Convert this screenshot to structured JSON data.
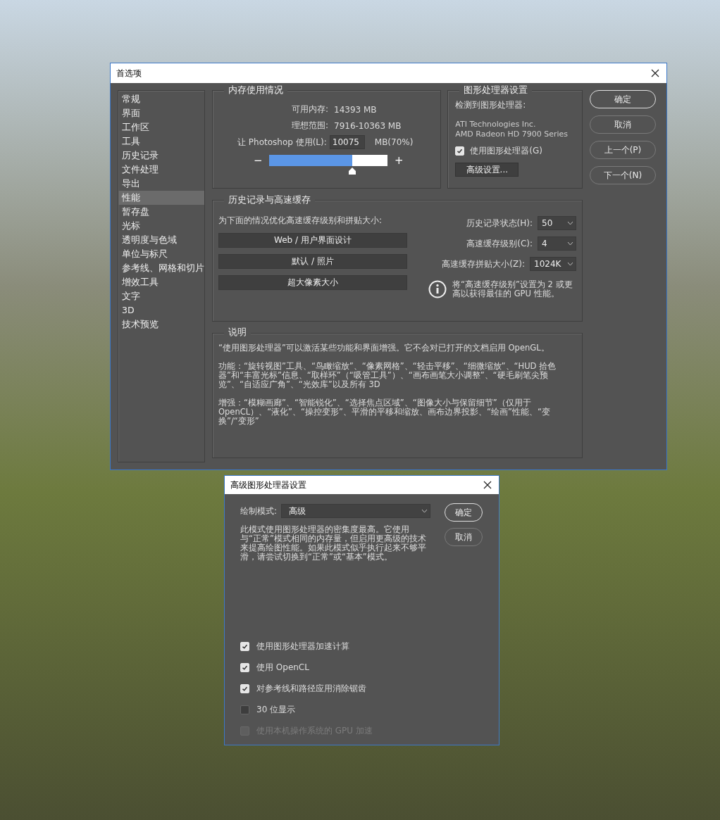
{
  "preferences_dialog": {
    "title": "首选项",
    "sidebar": {
      "items": [
        {
          "label": "常规",
          "selected": false
        },
        {
          "label": "界面",
          "selected": false
        },
        {
          "label": "工作区",
          "selected": false
        },
        {
          "label": "工具",
          "selected": false
        },
        {
          "label": "历史记录",
          "selected": false
        },
        {
          "label": "文件处理",
          "selected": false
        },
        {
          "label": "导出",
          "selected": false
        },
        {
          "label": "性能",
          "selected": true
        },
        {
          "label": "暂存盘",
          "selected": false
        },
        {
          "label": "光标",
          "selected": false
        },
        {
          "label": "透明度与色域",
          "selected": false
        },
        {
          "label": "单位与标尺",
          "selected": false
        },
        {
          "label": "参考线、网格和切片",
          "selected": false
        },
        {
          "label": "增效工具",
          "selected": false
        },
        {
          "label": "文字",
          "selected": false
        },
        {
          "label": "3D",
          "selected": false
        },
        {
          "label": "技术预览",
          "selected": false
        }
      ]
    },
    "memory_usage": {
      "title": "内存使用情况",
      "available_label": "可用内存:",
      "available_value": "14393 MB",
      "ideal_label": "理想范围:",
      "ideal_value": "7916-10363 MB",
      "use_label": "让 Photoshop 使用(L):",
      "use_value": "10075",
      "use_unit": "MB(70%)",
      "minus": "−",
      "plus": "+",
      "level": 0.7
    },
    "gpu_settings": {
      "title": "图形处理器设置",
      "detected_label": "检测到图形处理器:",
      "gpu_vendor": "ATI Technologies Inc.",
      "gpu_model": "AMD Radeon HD 7900 Series",
      "use_gpu": {
        "label": "使用图形处理器(G)",
        "checked": true
      },
      "advanced_button": "高级设置..."
    },
    "buttons": [
      {
        "label": "确定",
        "default": true
      },
      {
        "label": "取消",
        "default": false
      },
      {
        "label": "上一个(P)",
        "default": false
      },
      {
        "label": "下一个(N)",
        "default": false
      }
    ],
    "history_cache": {
      "title": "历史记录与高速缓存",
      "optimize_label": "为下面的情况优化高速缓存级别和拼贴大小:",
      "presets": [
        "Web / 用户界面设计",
        "默认 / 照片",
        "超大像素大小"
      ],
      "fields": [
        {
          "label": "历史记录状态(H):",
          "value": "50"
        },
        {
          "label": "高速缓存级别(C):",
          "value": "4"
        },
        {
          "label": "高速缓存拼贴大小(Z):",
          "value": "1024K"
        }
      ],
      "info": "将“高速缓存级别”设置为 2 或更高以获得最佳的 GPU 性能。"
    },
    "description": {
      "title": "说明",
      "paragraphs": [
        "“使用图形处理器”可以激活某些功能和界面增强。它不会对已打开的文档启用 OpenGL。",
        "功能：“旋转视图”工具、“鸟瞰缩放”、“像素网格”、“轻击平移”、“细微缩放”、“HUD 拾色器”和“丰富光标”信息、“取样环”（“吸管工具”）、“画布画笔大小调整”、“硬毛刷笔尖预览”、“自适应广角”、“光效库”以及所有 3D",
        "增强：“模糊画廊”、“智能锐化”、“选择焦点区域”、“图像大小与保留细节”（仅用于 OpenCL）、“液化”、“操控变形”、平滑的平移和缩放、画布边界投影、“绘画”性能、“变换”/“变形”"
      ]
    }
  },
  "advanced_dialog": {
    "title": "高级图形处理器设置",
    "mode_label": "绘制模式:",
    "mode_value": "高级",
    "mode_description": "此模式使用图形处理器的密集度最高。它使用与“正常”模式相同的内存量，但启用更高级的技术来提高绘图性能。如果此模式似乎执行起来不够平滑，请尝试切换到“正常”或“基本”模式。",
    "buttons": [
      {
        "label": "确定",
        "default": true
      },
      {
        "label": "取消",
        "default": false
      }
    ],
    "options": [
      {
        "label": "使用图形处理器加速计算",
        "checked": true,
        "disabled": false
      },
      {
        "label": "使用 OpenCL",
        "checked": true,
        "disabled": false
      },
      {
        "label": "对参考线和路径应用消除锯齿",
        "checked": true,
        "disabled": false
      },
      {
        "label": "30 位显示",
        "checked": false,
        "disabled": false
      },
      {
        "label": "使用本机操作系统的 GPU 加速",
        "checked": false,
        "disabled": true
      }
    ]
  }
}
